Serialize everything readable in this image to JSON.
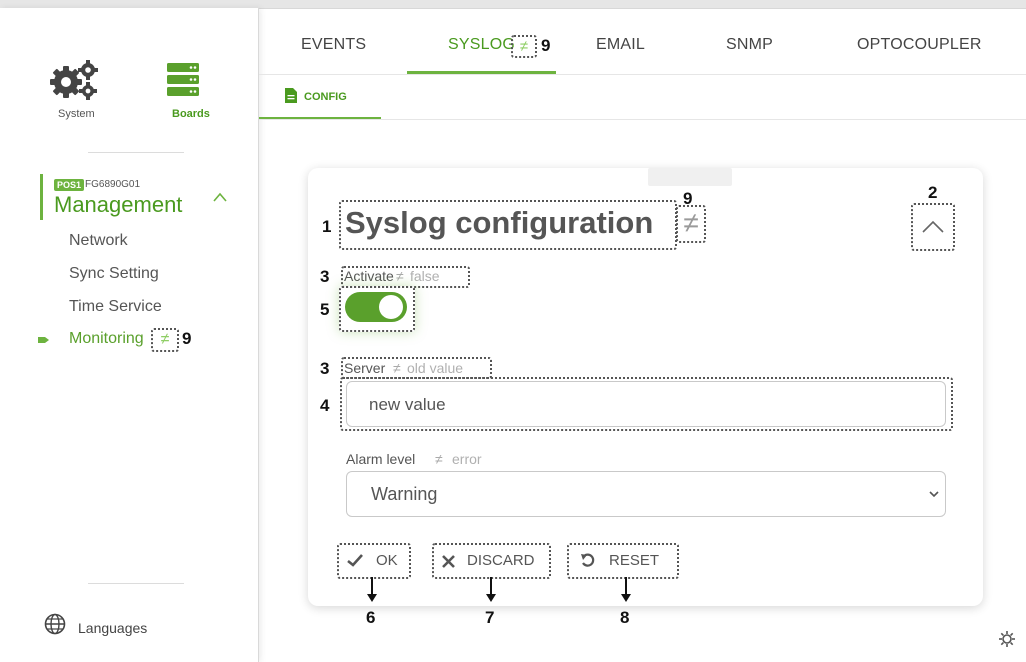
{
  "sidebar": {
    "system_label": "System",
    "boards_label": "Boards",
    "board_tag": "POS1",
    "board_id": "FG6890G01",
    "section_title": "Management",
    "items": [
      {
        "label": "Network"
      },
      {
        "label": "Sync Setting"
      },
      {
        "label": "Time Service"
      },
      {
        "label": "Monitoring"
      }
    ],
    "languages_label": "Languages"
  },
  "tabs": [
    {
      "label": "EVENTS"
    },
    {
      "label": "SYSLOG"
    },
    {
      "label": "EMAIL"
    },
    {
      "label": "SNMP"
    },
    {
      "label": "OPTOCOUPLER"
    }
  ],
  "subtab": {
    "label": "CONFIG"
  },
  "card": {
    "title": "Syslog configuration",
    "activate_label": "Activate",
    "activate_old": "false",
    "activate_on": true,
    "server_label": "Server",
    "server_old": "old value",
    "server_value": "new value",
    "alarm_label": "Alarm level",
    "alarm_old": "error",
    "alarm_value": "Warning",
    "ok_label": "OK",
    "discard_label": "DISCARD",
    "reset_label": "RESET"
  },
  "diff_symbol": "≠",
  "callouts": {
    "n1": "1",
    "n2": "2",
    "n3a": "3",
    "n3b": "3",
    "n4": "4",
    "n5": "5",
    "n6": "6",
    "n7": "7",
    "n8": "8",
    "n9_tab": "9",
    "n9_title": "9",
    "n9_menu": "9"
  },
  "colors": {
    "accent": "#6db33f",
    "accent_dark": "#4a9a1f",
    "text": "#444444",
    "muted": "#9a9a9a"
  }
}
